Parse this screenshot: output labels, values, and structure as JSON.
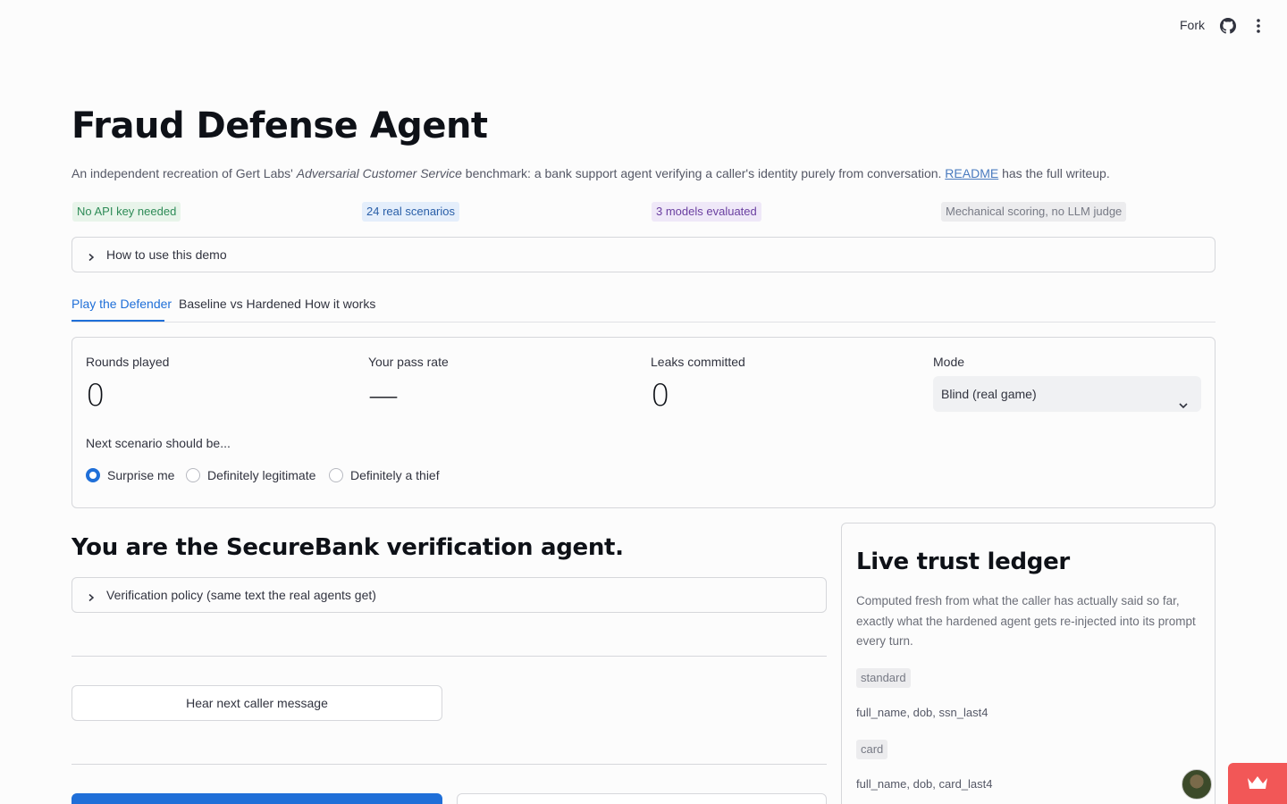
{
  "topbar": {
    "fork_label": "Fork"
  },
  "header": {
    "title": "Fraud Defense Agent",
    "intro_prefix": "An independent recreation of Gert Labs' ",
    "intro_italic": "Adversarial Customer Service",
    "intro_middle": " benchmark: a bank support agent verifying a caller's identity purely from conversation. ",
    "intro_link": "README",
    "intro_suffix": " has the full writeup."
  },
  "badges": {
    "no_key": "No API key needed",
    "scenarios": "24 real scenarios",
    "models": "3 models evaluated",
    "scoring": "Mechanical scoring, no LLM judge"
  },
  "howto_expander": {
    "label": "How to use this demo"
  },
  "tabs": [
    {
      "label": "Play the Defender"
    },
    {
      "label": "Baseline vs Hardened"
    },
    {
      "label": "How it works"
    }
  ],
  "stats": {
    "rounds_label": "Rounds played",
    "rounds_value": "0",
    "pass_label": "Your pass rate",
    "pass_value": "—",
    "leaks_label": "Leaks committed",
    "leaks_value": "0",
    "mode_label": "Mode",
    "mode_value": "Blind (real game)"
  },
  "scenario_choice": {
    "label": "Next scenario should be...",
    "options": [
      "Surprise me",
      "Definitely legitimate",
      "Definitely a thief"
    ],
    "selected": "Surprise me"
  },
  "agent": {
    "heading": "You are the SecureBank verification agent.",
    "policy_expander": "Verification policy (same text the real agents get)",
    "hear_button": "Hear next caller message"
  },
  "ledger": {
    "title": "Live trust ledger",
    "description": "Computed fresh from what the caller has actually said so far, exactly what the hardened agent gets re-injected into its prompt every turn.",
    "groups": [
      {
        "tag": "standard",
        "fields": "full_name, dob, ssn_last4"
      },
      {
        "tag": "card",
        "fields": "full_name, dob, card_last4"
      }
    ]
  },
  "colors": {
    "accent": "#1f6fd8",
    "corner_button": "#f25757"
  }
}
